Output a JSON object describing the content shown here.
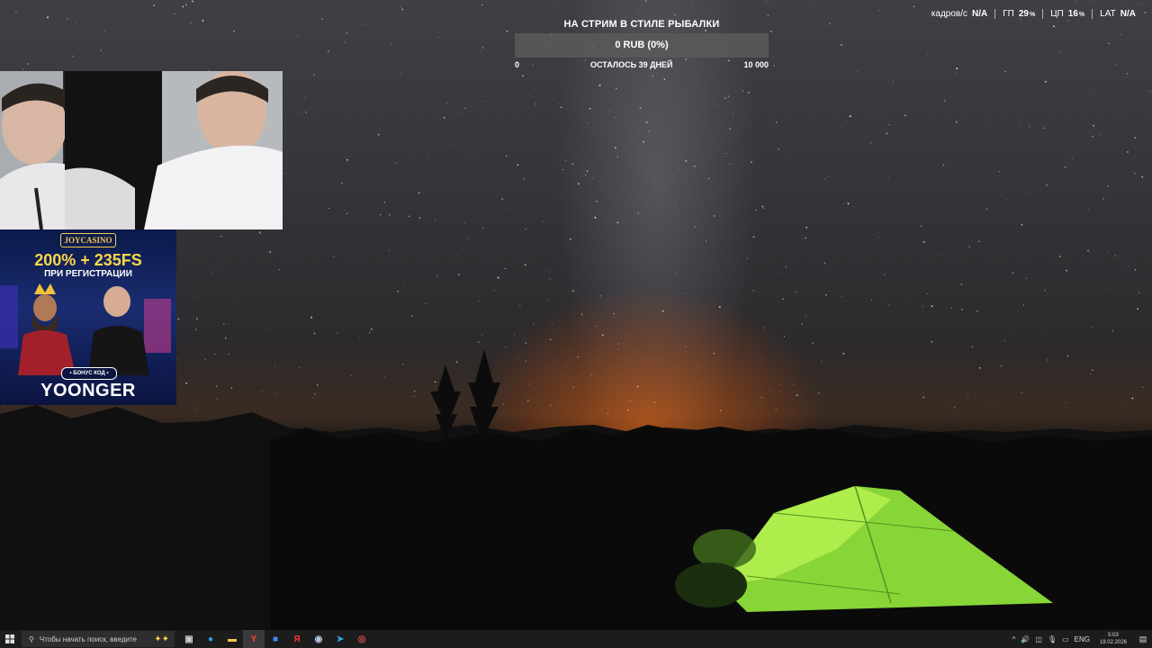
{
  "donation_goal": {
    "title": "НА СТРИМ В СТИЛЕ РЫБАЛКИ",
    "amount_text": "0 RUB (0%)",
    "progress": 0,
    "min": "0",
    "max": "10 000",
    "remaining": "ОСТАЛОСЬ 39 ДНЕЙ"
  },
  "stats": [
    {
      "label": "кадров/с",
      "value": "N/A",
      "unit": ""
    },
    {
      "label": "ГП",
      "value": "29",
      "unit": "%"
    },
    {
      "label": "ЦП",
      "value": "16",
      "unit": "%"
    },
    {
      "label": "LAT",
      "value": "N/A",
      "unit": ""
    }
  ],
  "ad": {
    "brand": "JOYCASINO",
    "headline": "200% + 235FS",
    "subheadline": "ПРИ РЕГИСТРАЦИИ",
    "badge": "• БОНУС КОД •",
    "code": "YOONGER"
  },
  "taskbar": {
    "search_placeholder": "Чтобы начать поиск, введите",
    "apps": [
      {
        "name": "task-view-icon",
        "glyph": "▣",
        "color": "#cfcfcf"
      },
      {
        "name": "edge-icon",
        "glyph": "●",
        "color": "#2aa5e0"
      },
      {
        "name": "file-explorer-icon",
        "glyph": "▬",
        "color": "#f2c94c"
      },
      {
        "name": "yandex-browser-icon",
        "glyph": "Y",
        "color": "#ff4a2b",
        "active": true
      },
      {
        "name": "store-icon",
        "glyph": "■",
        "color": "#3d8bfd"
      },
      {
        "name": "yandex-icon",
        "glyph": "Я",
        "color": "#ff3333"
      },
      {
        "name": "steam-icon",
        "glyph": "◉",
        "color": "#b7c8e0"
      },
      {
        "name": "telegram-icon",
        "glyph": "➤",
        "color": "#35a6de"
      },
      {
        "name": "obs-icon",
        "glyph": "◎",
        "color": "#e05050"
      }
    ],
    "tray": {
      "language": "ENG",
      "time": "5:03",
      "date": "19.02.2026"
    }
  }
}
